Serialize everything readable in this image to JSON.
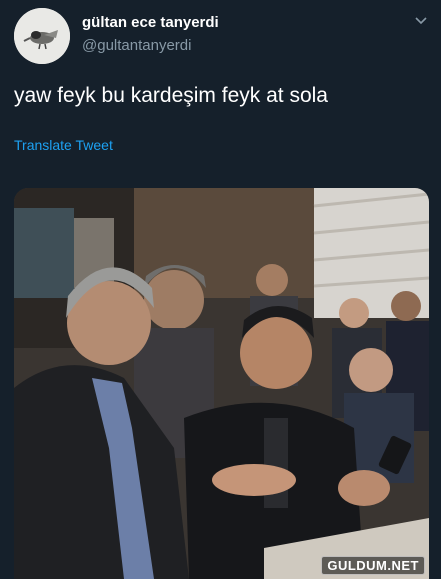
{
  "tweet": {
    "display_name": "gültan ece tanyerdi",
    "handle": "@gultantanyerdi",
    "text": "yaw feyk bu kardeşim feyk at sola",
    "translate_label": "Translate Tweet"
  },
  "icons": {
    "avatar": "avatar-bird-image",
    "menu": "chevron-down-icon"
  },
  "colors": {
    "background": "#15202b",
    "link": "#1da1f2",
    "secondary_text": "#8899a6"
  },
  "watermark": "GULDUM.NET"
}
